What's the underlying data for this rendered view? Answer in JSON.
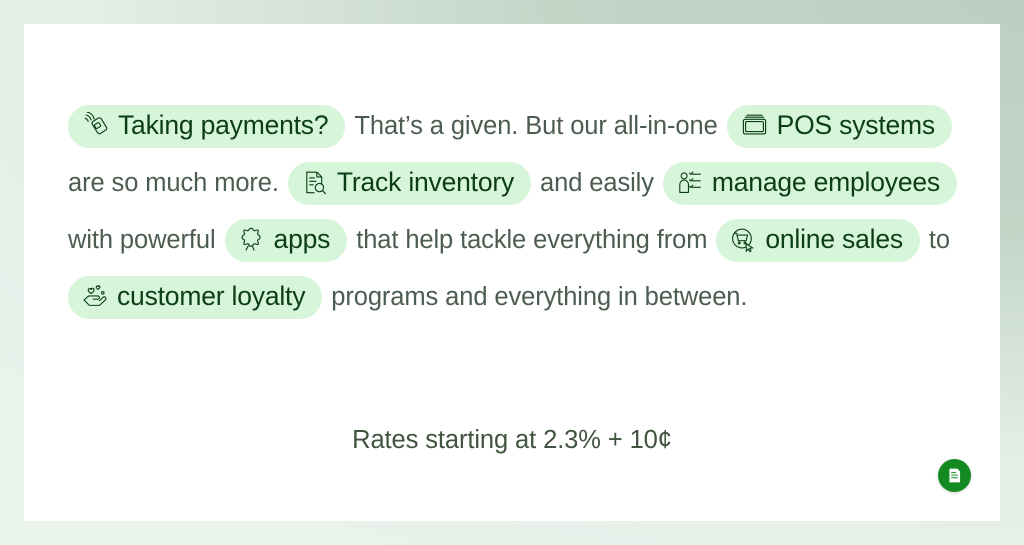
{
  "theme": {
    "page_background": "#c1d2c6",
    "card_background": "#ffffff",
    "pill_background": "#d6f5d9",
    "pill_text": "#0c3d19",
    "body_text": "#4c5d50",
    "accent_green": "#128a21"
  },
  "content": {
    "line1": {
      "pill_a": {
        "label": "Taking payments?",
        "icon": "contactless-payment-icon"
      },
      "text_a": "That’s a given. But our all-in-one",
      "pill_b": {
        "label": "POS systems",
        "icon": "pos-terminal-icon"
      }
    },
    "line2": {
      "text_a": "are so much more.",
      "pill_a": {
        "label": "Track inventory",
        "icon": "document-search-icon"
      },
      "text_b": "and easily",
      "pill_b": {
        "label": "manage employees",
        "icon": "person-checklist-icon"
      }
    },
    "line3": {
      "text_a": "with powerful",
      "pill_a": {
        "label": "apps",
        "icon": "puzzle-piece-icon"
      },
      "text_b": "that help tackle everything from",
      "pill_b": {
        "label": "online sales",
        "icon": "cart-cursor-icon"
      },
      "text_c": "to"
    },
    "line4": {
      "pill_a": {
        "label": "customer loyalty",
        "icon": "hand-hearts-icon"
      },
      "text_a": "programs and everything in between."
    }
  },
  "rates": {
    "text": "Rates starting at 2.3% + 10¢"
  },
  "fab": {
    "name": "receipt-document-button",
    "icon": "receipt-document-icon"
  }
}
